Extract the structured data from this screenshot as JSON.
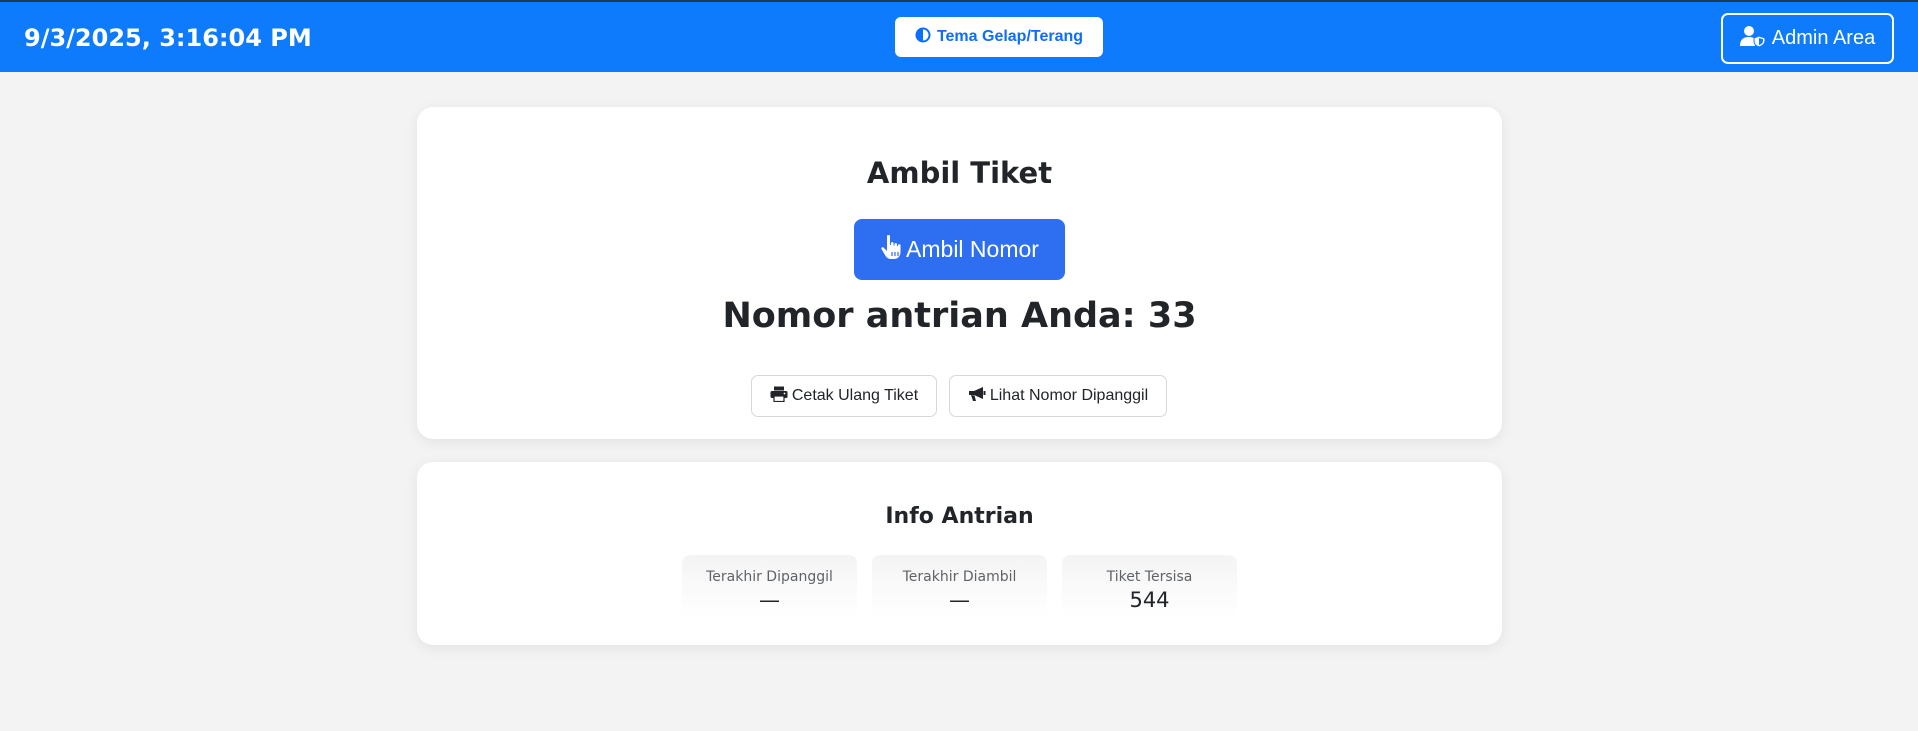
{
  "header": {
    "datetime": "9/3/2025, 3:16:04 PM",
    "theme_button": {
      "label": "Tema Gelap/Terang",
      "icon": "contrast-icon"
    },
    "admin_button": {
      "label": "Admin Area",
      "icon": "user-shield-icon"
    }
  },
  "ticket": {
    "title": "Ambil Tiket",
    "take_button": {
      "label": "Ambil Nomor",
      "icon": "hand-pointer-icon"
    },
    "queue_number_text": "Nomor antrian Anda: 33",
    "reprint_button": {
      "label": "Cetak Ulang Tiket",
      "icon": "print-icon"
    },
    "called_button": {
      "label": "Lihat Nomor Dipanggil",
      "icon": "bullhorn-icon"
    }
  },
  "info": {
    "title": "Info Antrian",
    "stats": [
      {
        "label": "Terakhir Dipanggil",
        "value": "—"
      },
      {
        "label": "Terakhir Diambil",
        "value": "—"
      },
      {
        "label": "Tiket Tersisa",
        "value": "544"
      }
    ]
  },
  "colors": {
    "header_bg": "#0d7bfb",
    "primary_button": "#2e6ff2",
    "page_bg": "#f3f3f3"
  }
}
